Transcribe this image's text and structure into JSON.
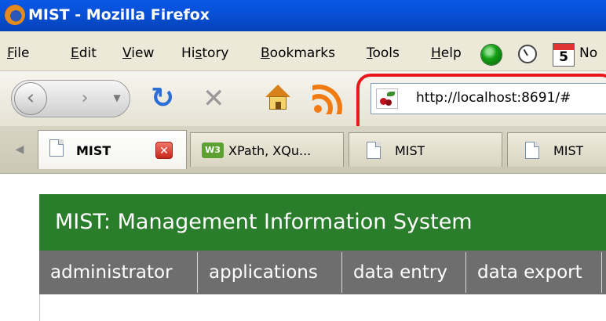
{
  "window": {
    "title": "MIST - Mozilla Firefox"
  },
  "menubar": {
    "items": [
      {
        "accel": "F",
        "rest": "ile"
      },
      {
        "accel": "E",
        "rest": "dit"
      },
      {
        "accel": "V",
        "rest": "iew"
      },
      {
        "pre": "Hi",
        "accel": "s",
        "rest": "tory"
      },
      {
        "accel": "B",
        "rest": "ookmarks"
      },
      {
        "accel": "T",
        "rest": "ools"
      },
      {
        "accel": "H",
        "rest": "elp"
      }
    ],
    "calendar_day": "5",
    "truncated_text": "No"
  },
  "navbar": {
    "url": "http://localhost:8691/#",
    "highlight_color": "#e8171d"
  },
  "tabs": [
    {
      "label": "MIST",
      "active": true
    },
    {
      "label": "XPath, XQu...",
      "icon": "w3c-icon",
      "icon_text": "W3"
    },
    {
      "label": "MIST"
    },
    {
      "label": "MIST"
    }
  ],
  "app": {
    "header_title": "MIST: Management Information System",
    "header_color": "#2a7d2a",
    "nav_color": "#6e6e6e",
    "nav_items": [
      "administrator",
      "applications",
      "data entry",
      "data export"
    ]
  }
}
